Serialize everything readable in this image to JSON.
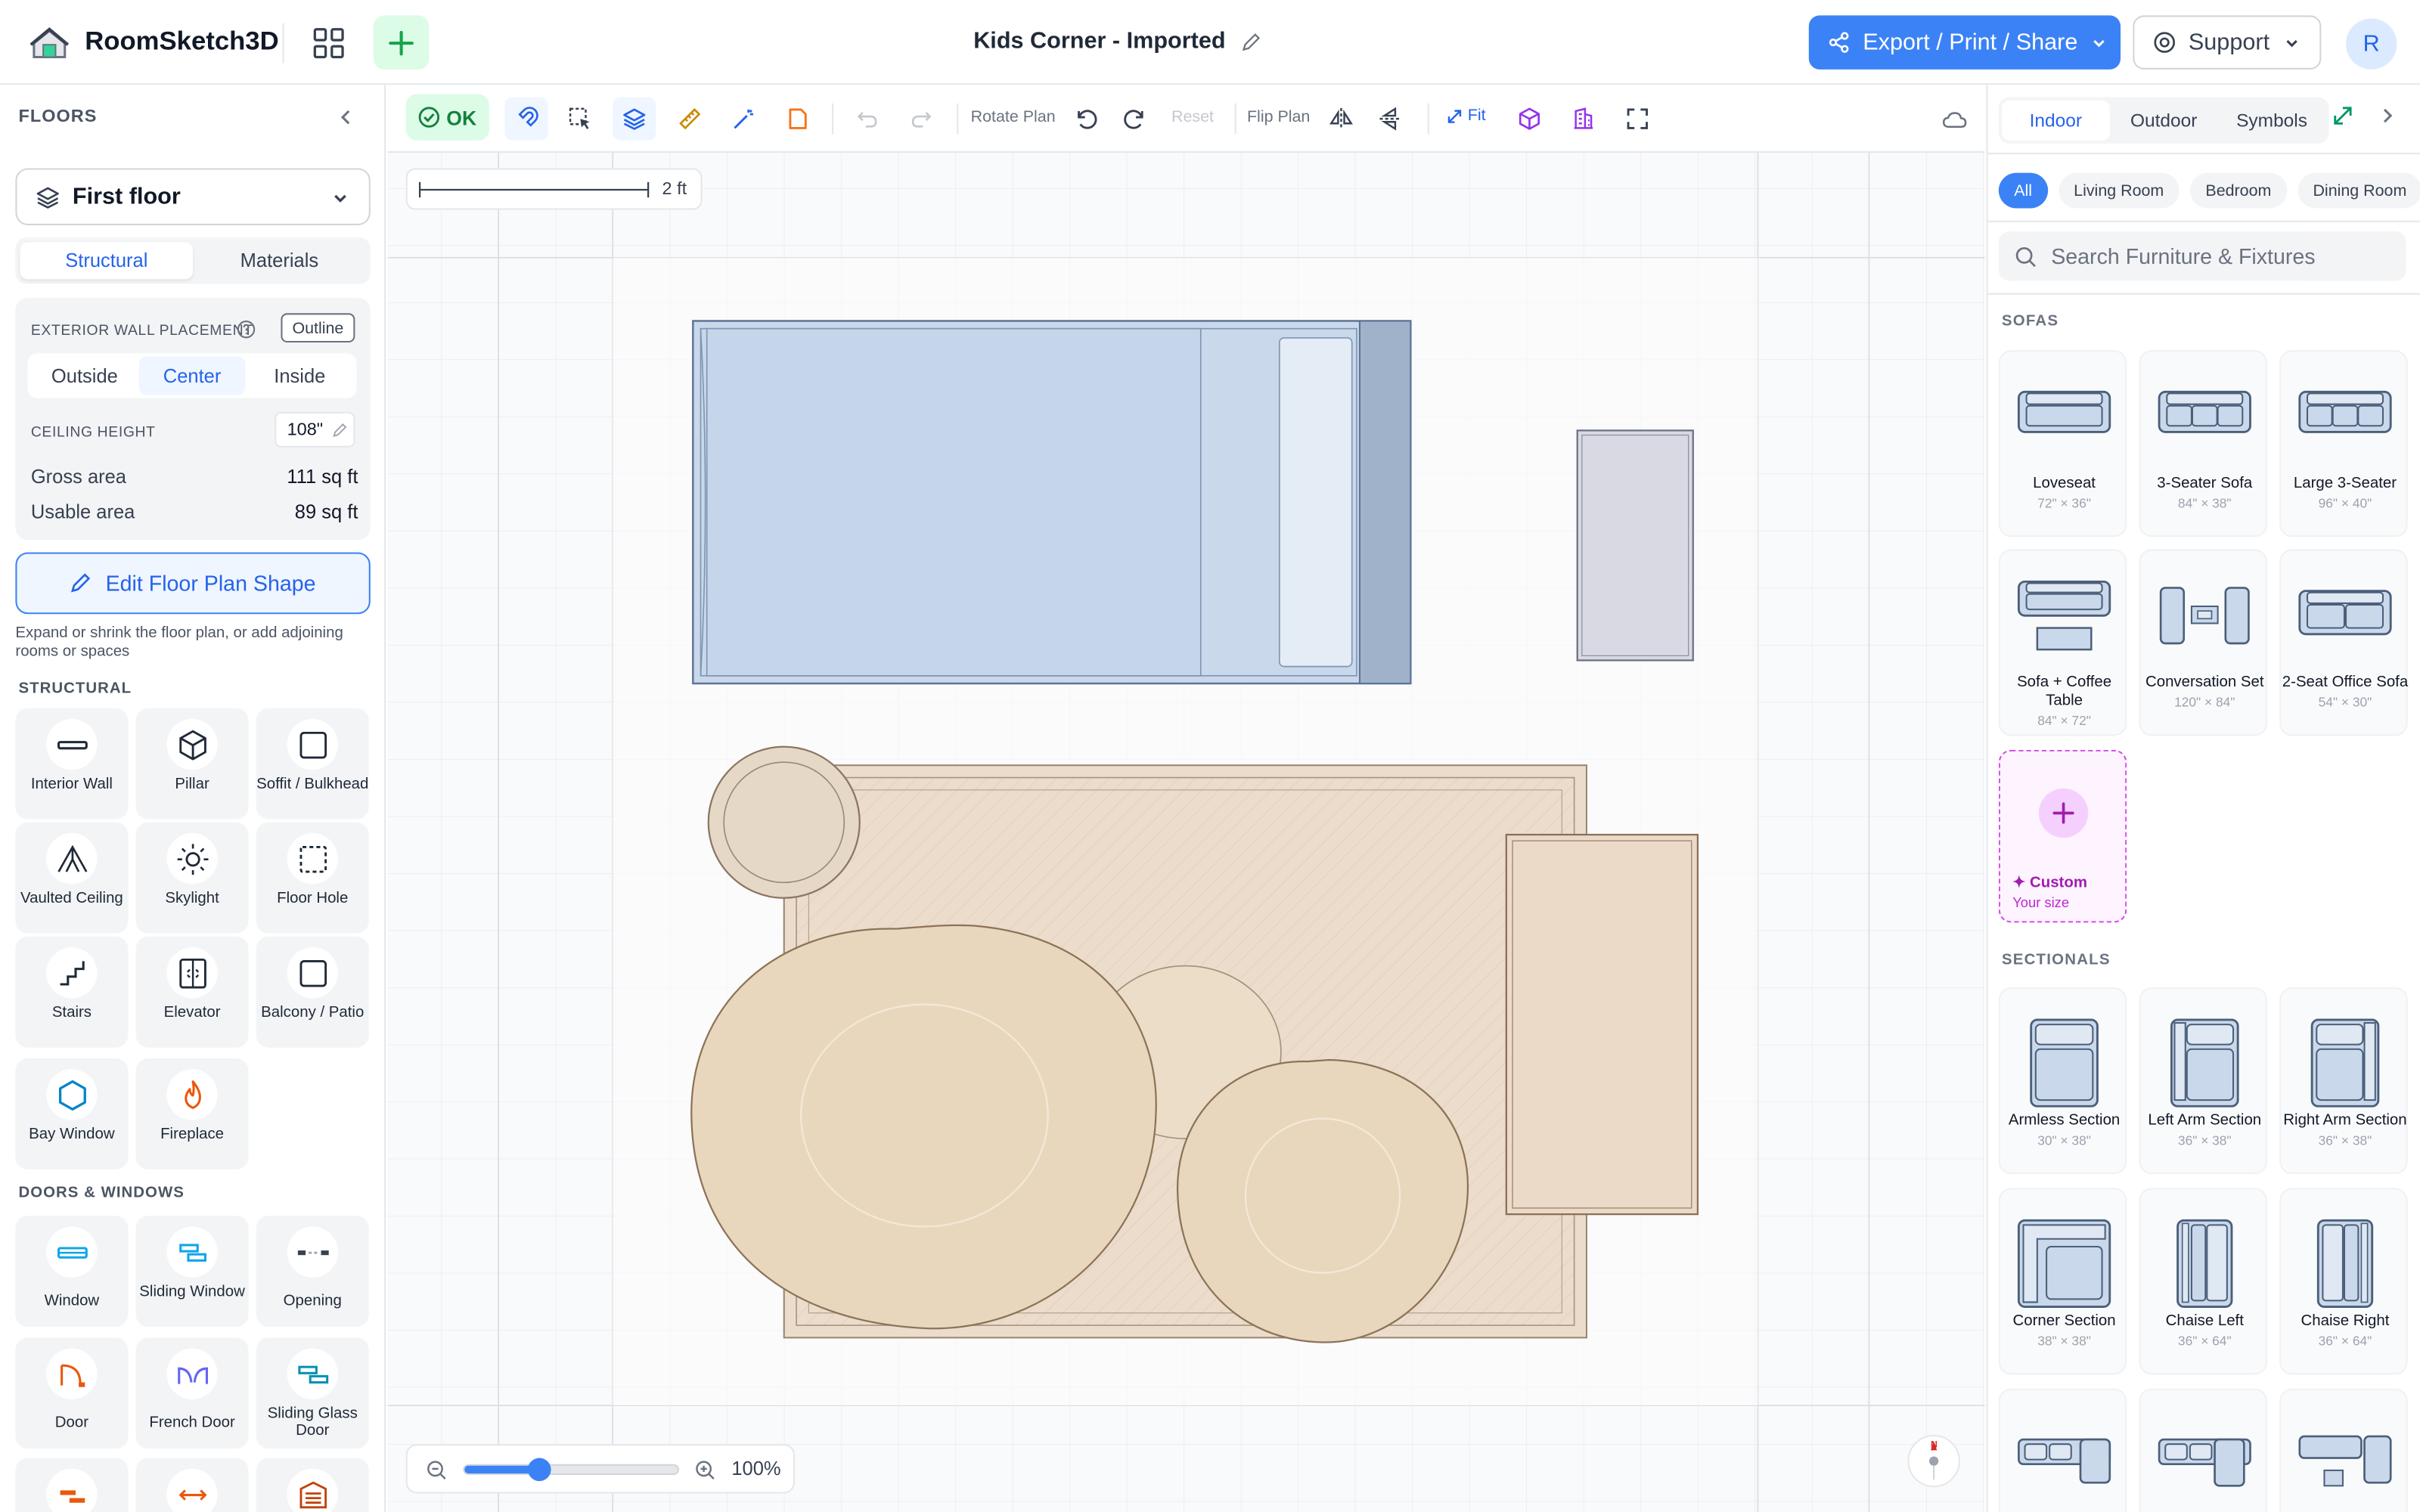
{
  "header": {
    "brand": "RoomSketch3D",
    "doc_title": "Kids Corner - Imported",
    "export_label": "Export / Print / Share",
    "support_label": "Support",
    "avatar_initial": "R"
  },
  "left": {
    "floors_label": "FLOORS",
    "floor_selected": "First floor",
    "tabs": [
      "Structural",
      "Materials"
    ],
    "active_tab": "Structural",
    "wall_placement_label": "EXTERIOR WALL PLACEMENT",
    "outline_label": "Outline",
    "placement_options": [
      "Outside",
      "Center",
      "Inside"
    ],
    "placement_active": "Center",
    "ceiling_label": "CEILING HEIGHT",
    "ceiling_value": "108\"",
    "gross_label": "Gross area",
    "gross_value": "111 sq ft",
    "usable_label": "Usable area",
    "usable_value": "89 sq ft",
    "edit_shape_label": "Edit Floor Plan Shape",
    "edit_hint": "Expand or shrink the floor plan, or add adjoining rooms or spaces",
    "structural_head": "STRUCTURAL",
    "structural_tools": [
      {
        "label": "Interior Wall",
        "icon": "interior-wall-icon"
      },
      {
        "label": "Pillar",
        "icon": "pillar-icon"
      },
      {
        "label": "Soffit / Bulkhead",
        "icon": "soffit-icon"
      },
      {
        "label": "Vaulted Ceiling",
        "icon": "vaulted-ceiling-icon"
      },
      {
        "label": "Skylight",
        "icon": "skylight-icon"
      },
      {
        "label": "Floor Hole",
        "icon": "floor-hole-icon"
      },
      {
        "label": "Stairs",
        "icon": "stairs-icon"
      },
      {
        "label": "Elevator",
        "icon": "elevator-icon"
      },
      {
        "label": "Balcony / Patio",
        "icon": "balcony-icon"
      },
      {
        "label": "Bay Window",
        "icon": "bay-window-icon"
      },
      {
        "label": "Fireplace",
        "icon": "fireplace-icon"
      }
    ],
    "doors_head": "DOORS & WINDOWS",
    "door_tools": [
      {
        "label": "Window",
        "icon": "window-icon"
      },
      {
        "label": "Sliding Window",
        "icon": "sliding-window-icon"
      },
      {
        "label": "Opening",
        "icon": "opening-icon"
      },
      {
        "label": "Door",
        "icon": "door-icon"
      },
      {
        "label": "French Door",
        "icon": "french-door-icon"
      },
      {
        "label": "Sliding Glass Door",
        "icon": "sliding-glass-door-icon"
      }
    ]
  },
  "toolbar": {
    "ok_label": "OK",
    "rotate_label": "Rotate Plan",
    "reset_label": "Reset",
    "flip_label": "Flip Plan",
    "fit_label": "Fit"
  },
  "canvas": {
    "scale_label": "2 ft",
    "zoom_value": 35,
    "zoom_label": "100%",
    "compass_n": "N"
  },
  "right": {
    "tabs": [
      "Indoor",
      "Outdoor",
      "Symbols"
    ],
    "active_tab": "Indoor",
    "chips": [
      "All",
      "Living Room",
      "Bedroom",
      "Dining Room"
    ],
    "active_chip": "All",
    "search_placeholder": "Search Furniture & Fixtures",
    "sofas_head": "SOFAS",
    "sofas": [
      {
        "name": "Loveseat",
        "dims": "72\" × 36\""
      },
      {
        "name": "3-Seater Sofa",
        "dims": "84\" × 38\""
      },
      {
        "name": "Large 3-Seater",
        "dims": "96\" × 40\""
      },
      {
        "name": "Sofa + Coffee Table",
        "dims": "84\" × 72\""
      },
      {
        "name": "Conversation Set",
        "dims": "120\" × 84\""
      },
      {
        "name": "2-Seat Office Sofa",
        "dims": "54\" × 30\""
      }
    ],
    "custom_label": "Custom",
    "custom_sub": "Your size",
    "sectionals_head": "SECTIONALS",
    "sectionals": [
      {
        "name": "Armless Section",
        "dims": "30\" × 38\""
      },
      {
        "name": "Left Arm Section",
        "dims": "36\" × 38\""
      },
      {
        "name": "Right Arm Section",
        "dims": "36\" × 38\""
      },
      {
        "name": "Corner Section",
        "dims": "38\" × 38\""
      },
      {
        "name": "Chaise Left",
        "dims": "36\" × 64\""
      },
      {
        "name": "Chaise Right",
        "dims": "36\" × 64\""
      }
    ]
  },
  "colors": {
    "accent": "#3b82f6",
    "ok_green": "#15803d",
    "bed_fill": "#c9d8ea",
    "rug_fill": "#ebdccb",
    "pouf_fill": "#e9d7bd"
  }
}
